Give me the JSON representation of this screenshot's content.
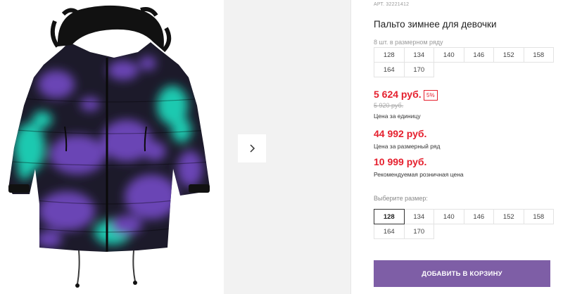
{
  "product": {
    "sku": "АРТ. 32221412",
    "title": "Пальто зимнее для девочки",
    "pack_note": "8 шт. в размерном ряду",
    "pack_sizes": [
      "128",
      "134",
      "140",
      "146",
      "152",
      "158",
      "164",
      "170"
    ],
    "price": {
      "current": "5 624 руб.",
      "discount": "5%",
      "old": "5 920 руб.",
      "unit_caption": "Цена за единицу",
      "pack_price": "44 992 руб.",
      "pack_caption": "Цена за размерный ряд",
      "retail_price": "10 999 руб.",
      "retail_caption": "Рекомендуемая розничная цена"
    },
    "size_select": {
      "label": "Выберите размер:",
      "options": [
        "128",
        "134",
        "140",
        "146",
        "152",
        "158",
        "164",
        "170"
      ],
      "selected": "128"
    },
    "add_to_cart_label": "ДОБАВИТЬ В КОРЗИНУ"
  },
  "gallery": {
    "next_icon": "chevron-right-icon"
  },
  "colors": {
    "accent": "#7e5ea6",
    "price_red": "#e5202e",
    "coat_dark": "#1c1a2a",
    "coat_purple": "#6b45b5",
    "coat_teal": "#1fc9b0",
    "fur": "#111111"
  }
}
